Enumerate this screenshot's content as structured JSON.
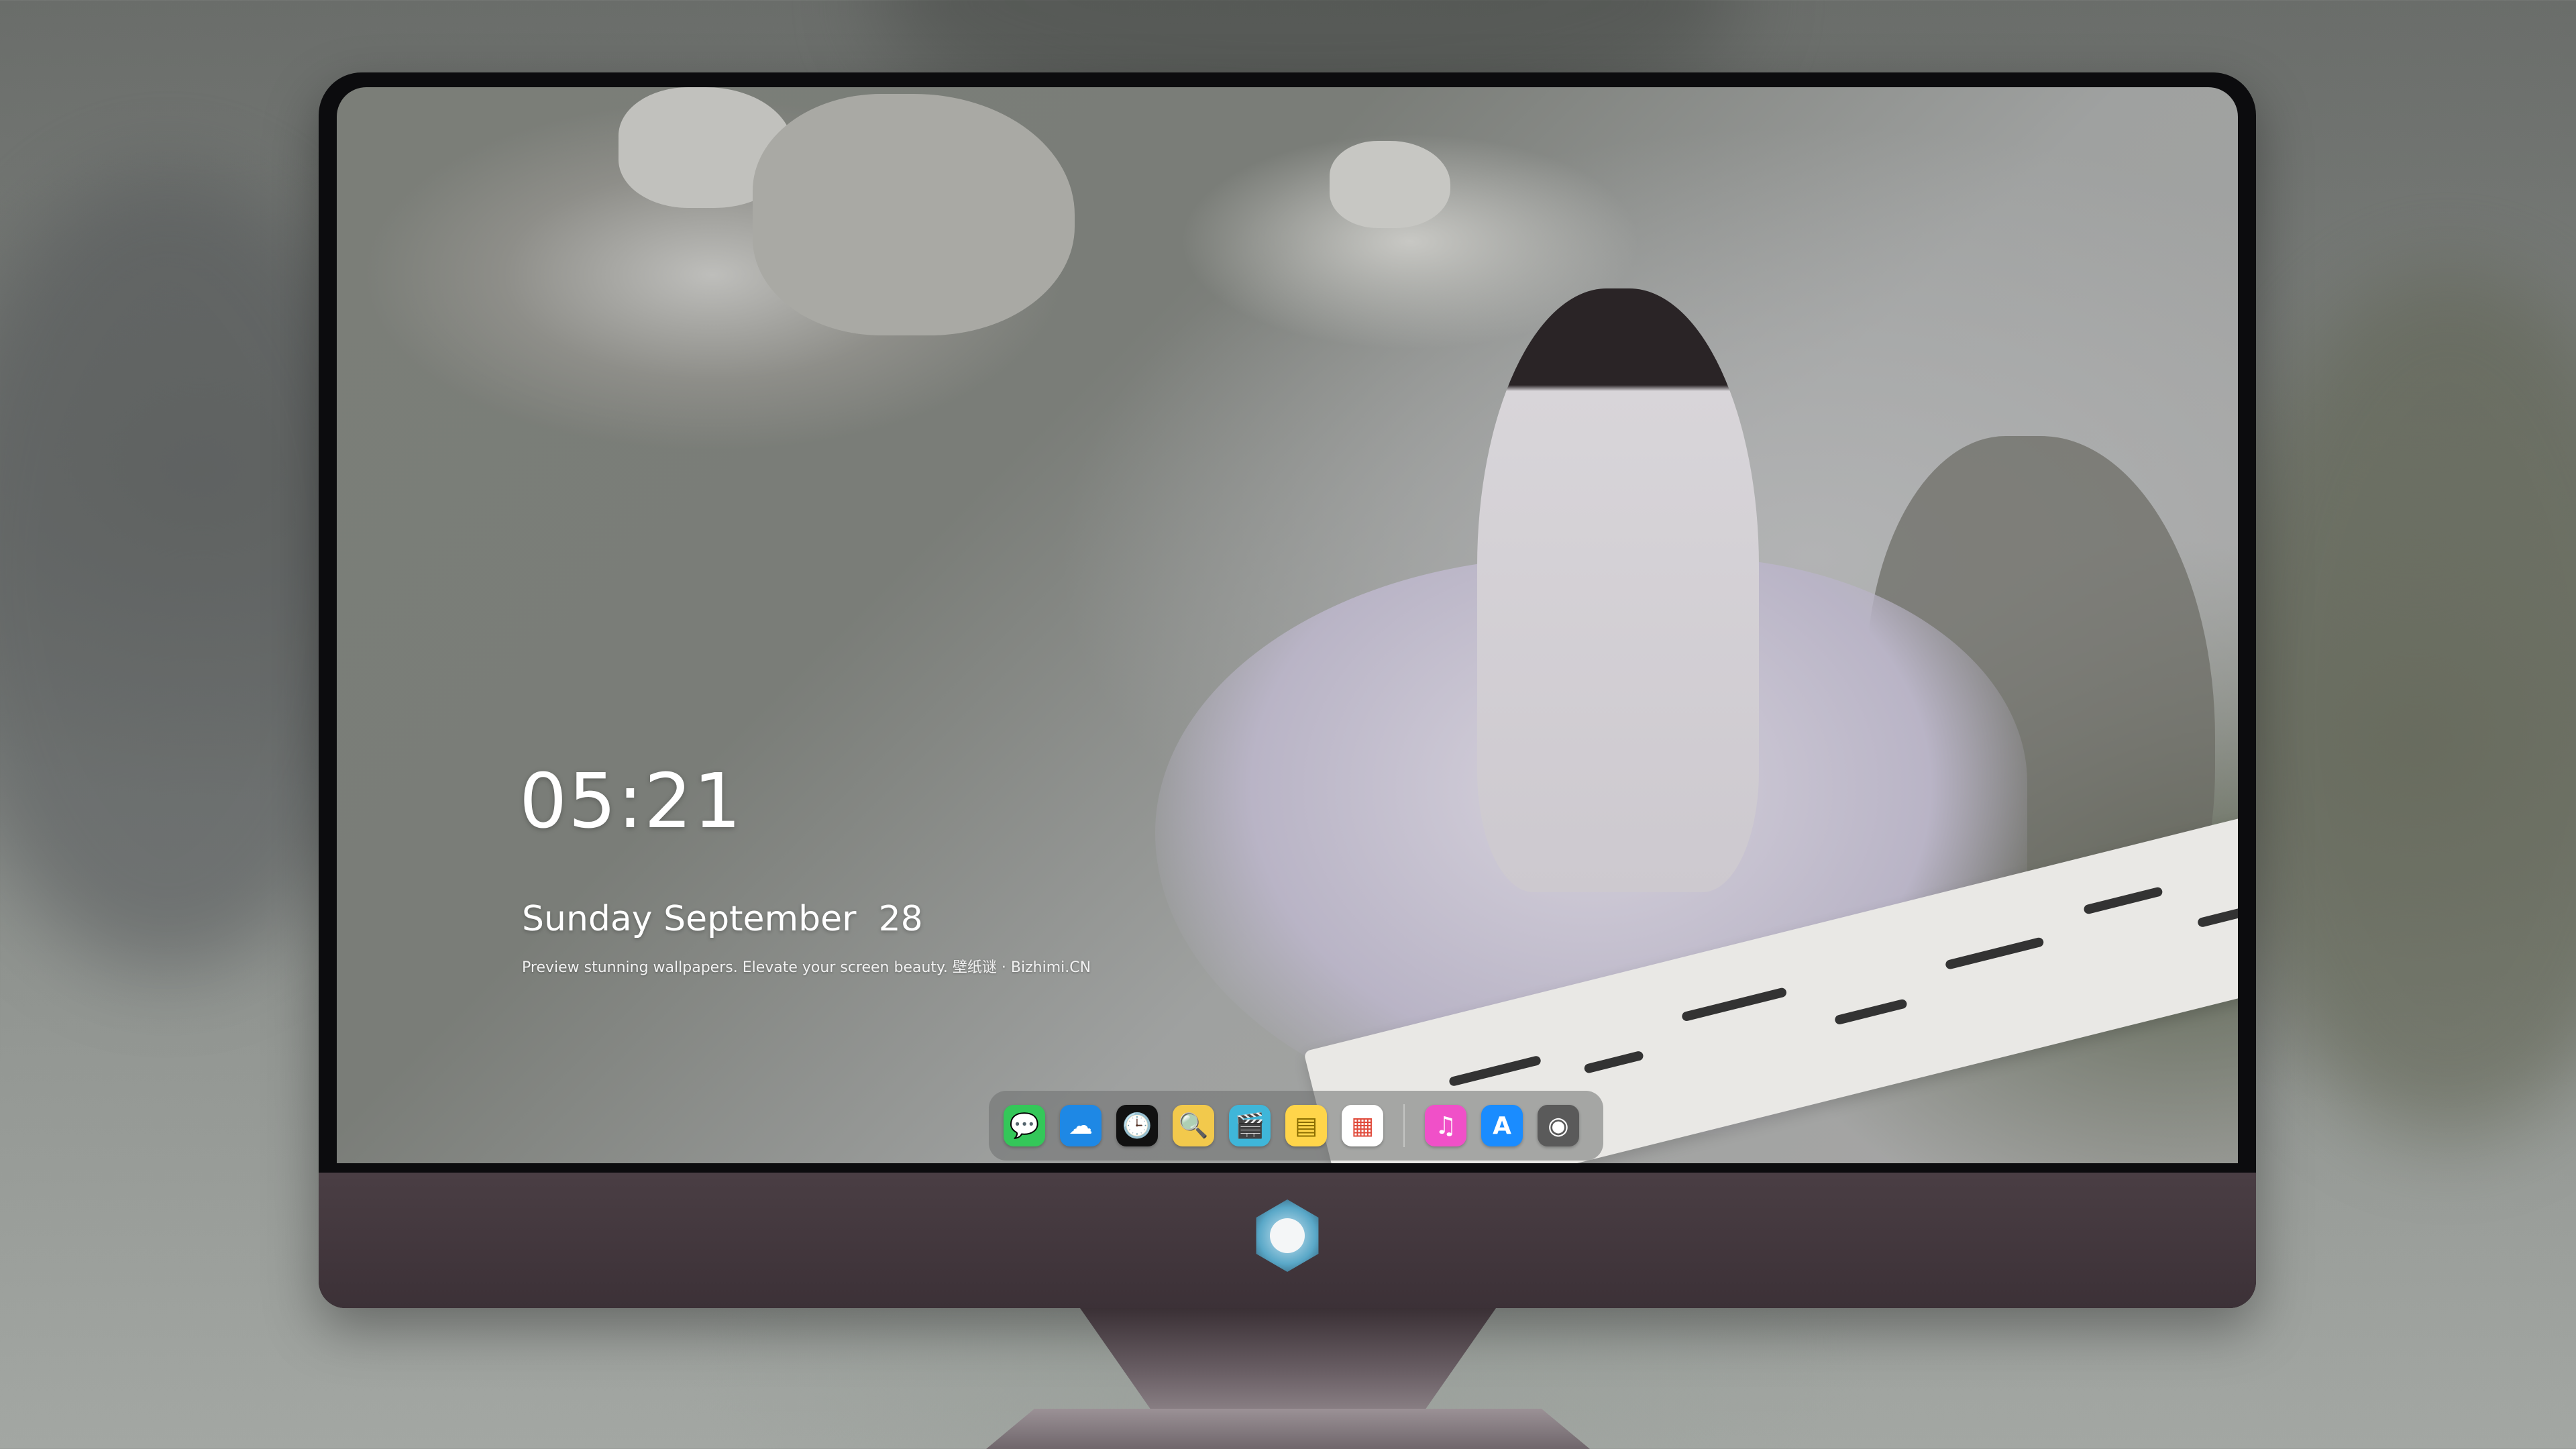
{
  "lockscreen": {
    "time": "05:21",
    "date": "Sunday September  28",
    "tagline": "Preview stunning wallpapers. Elevate your screen beauty. 壁纸谜 · Bizhimi.CN"
  },
  "dock": {
    "apps": [
      {
        "name": "messages-icon",
        "glyph": "💬",
        "color": "#34c759"
      },
      {
        "name": "weather-icon",
        "glyph": "☁",
        "color": "#1e88e5"
      },
      {
        "name": "clock-icon",
        "glyph": "🕒",
        "color": "#111111"
      },
      {
        "name": "preview-icon",
        "glyph": "🔍",
        "color": "#f2c94c"
      },
      {
        "name": "clips-icon",
        "glyph": "🎬",
        "color": "#3fb6d9"
      },
      {
        "name": "notes-icon",
        "glyph": "▤",
        "color": "#ffd54a"
      },
      {
        "name": "photo-booth-icon",
        "glyph": "▦",
        "color": "#ffffff"
      },
      {
        "name": "music-icon",
        "glyph": "♫",
        "color": "#f050c8"
      },
      {
        "name": "app-store-icon",
        "glyph": "A",
        "color": "#1a8cff"
      },
      {
        "name": "camera-icon",
        "glyph": "◉",
        "color": "#5a5a5a"
      }
    ]
  }
}
